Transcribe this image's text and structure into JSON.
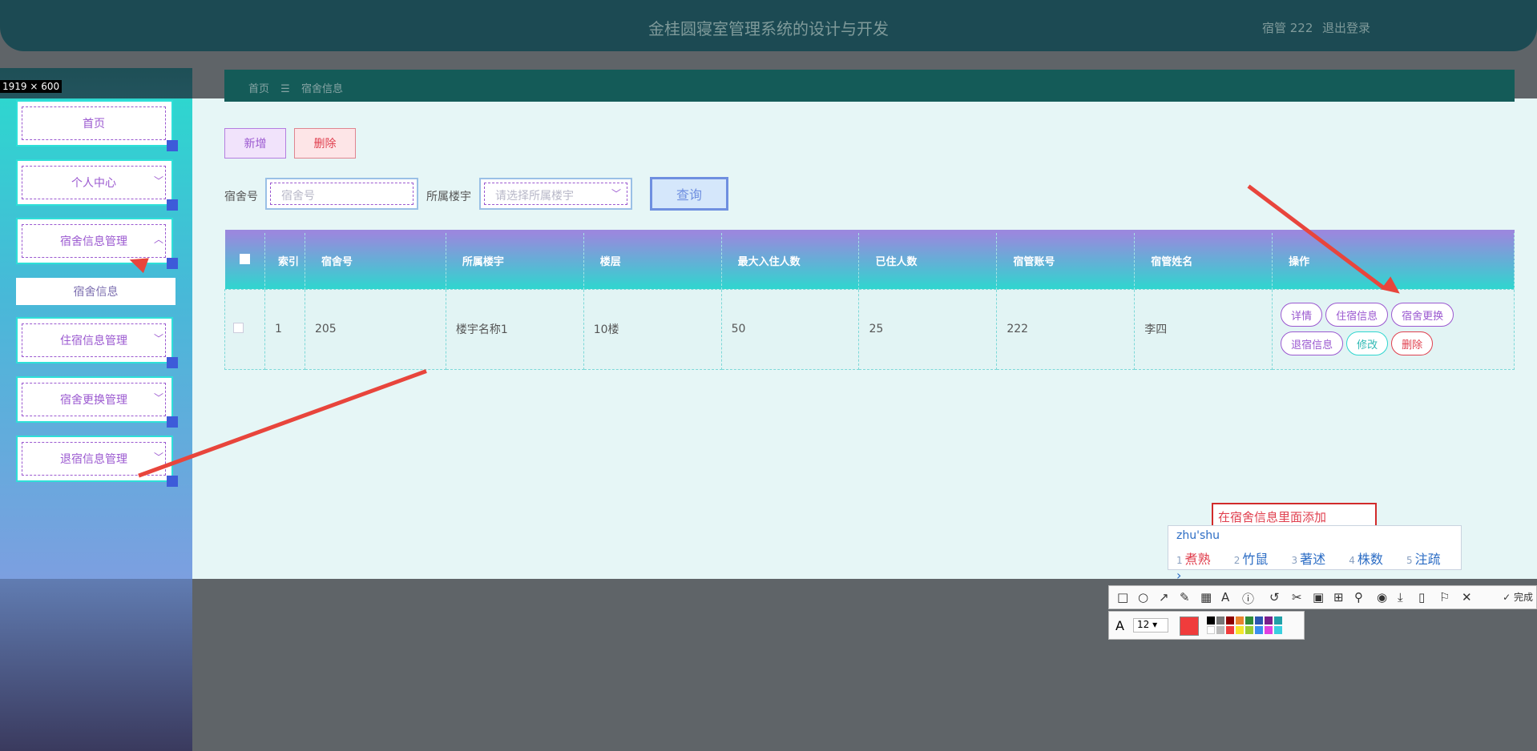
{
  "header": {
    "title": "金桂圆寝室管理系统的设计与开发",
    "user": "宿管 222",
    "logout": "退出登录"
  },
  "size_tag": "1919 × 600",
  "sidebar": {
    "items": [
      {
        "label": "首页"
      },
      {
        "label": "个人中心"
      },
      {
        "label": "宿舍信息管理"
      },
      {
        "label": "住宿信息管理"
      },
      {
        "label": "宿舍更换管理"
      },
      {
        "label": "退宿信息管理"
      }
    ],
    "sub_item": "宿舍信息"
  },
  "breadcrumb": {
    "home": "首页",
    "sep": "☰",
    "current": "宿舍信息"
  },
  "actions": {
    "add": "新增",
    "delete": "删除"
  },
  "search": {
    "room_label": "宿舍号",
    "room_placeholder": "宿舍号",
    "building_label": "所属楼宇",
    "building_placeholder": "请选择所属楼宇",
    "query": "查询"
  },
  "table": {
    "headers": [
      "索引",
      "宿舍号",
      "所属楼宇",
      "楼层",
      "最大入住人数",
      "已住人数",
      "宿管账号",
      "宿管姓名",
      "操作"
    ],
    "rows": [
      {
        "index": "1",
        "room": "205",
        "building": "楼宇名称1",
        "floor": "10楼",
        "max": "50",
        "current": "25",
        "account": "222",
        "name": "李四"
      }
    ],
    "ops": {
      "detail": "详情",
      "stay": "住宿信息",
      "change": "宿舍更换",
      "checkout": "退宿信息",
      "edit": "修改",
      "delete": "删除"
    }
  },
  "annotation": {
    "note": "在宿舍信息里面添加"
  },
  "ime": {
    "composition": "zhu'shu",
    "candidates": [
      "煮熟",
      "竹鼠",
      "著述",
      "株数",
      "注疏"
    ]
  },
  "screenshot_toolbar": {
    "done": "完成",
    "font_size": "12"
  },
  "colors": {
    "accent_teal": "#2fd6cf",
    "accent_purple": "#9b59d0",
    "danger": "#e0404f",
    "arrow": "#e8453c"
  }
}
